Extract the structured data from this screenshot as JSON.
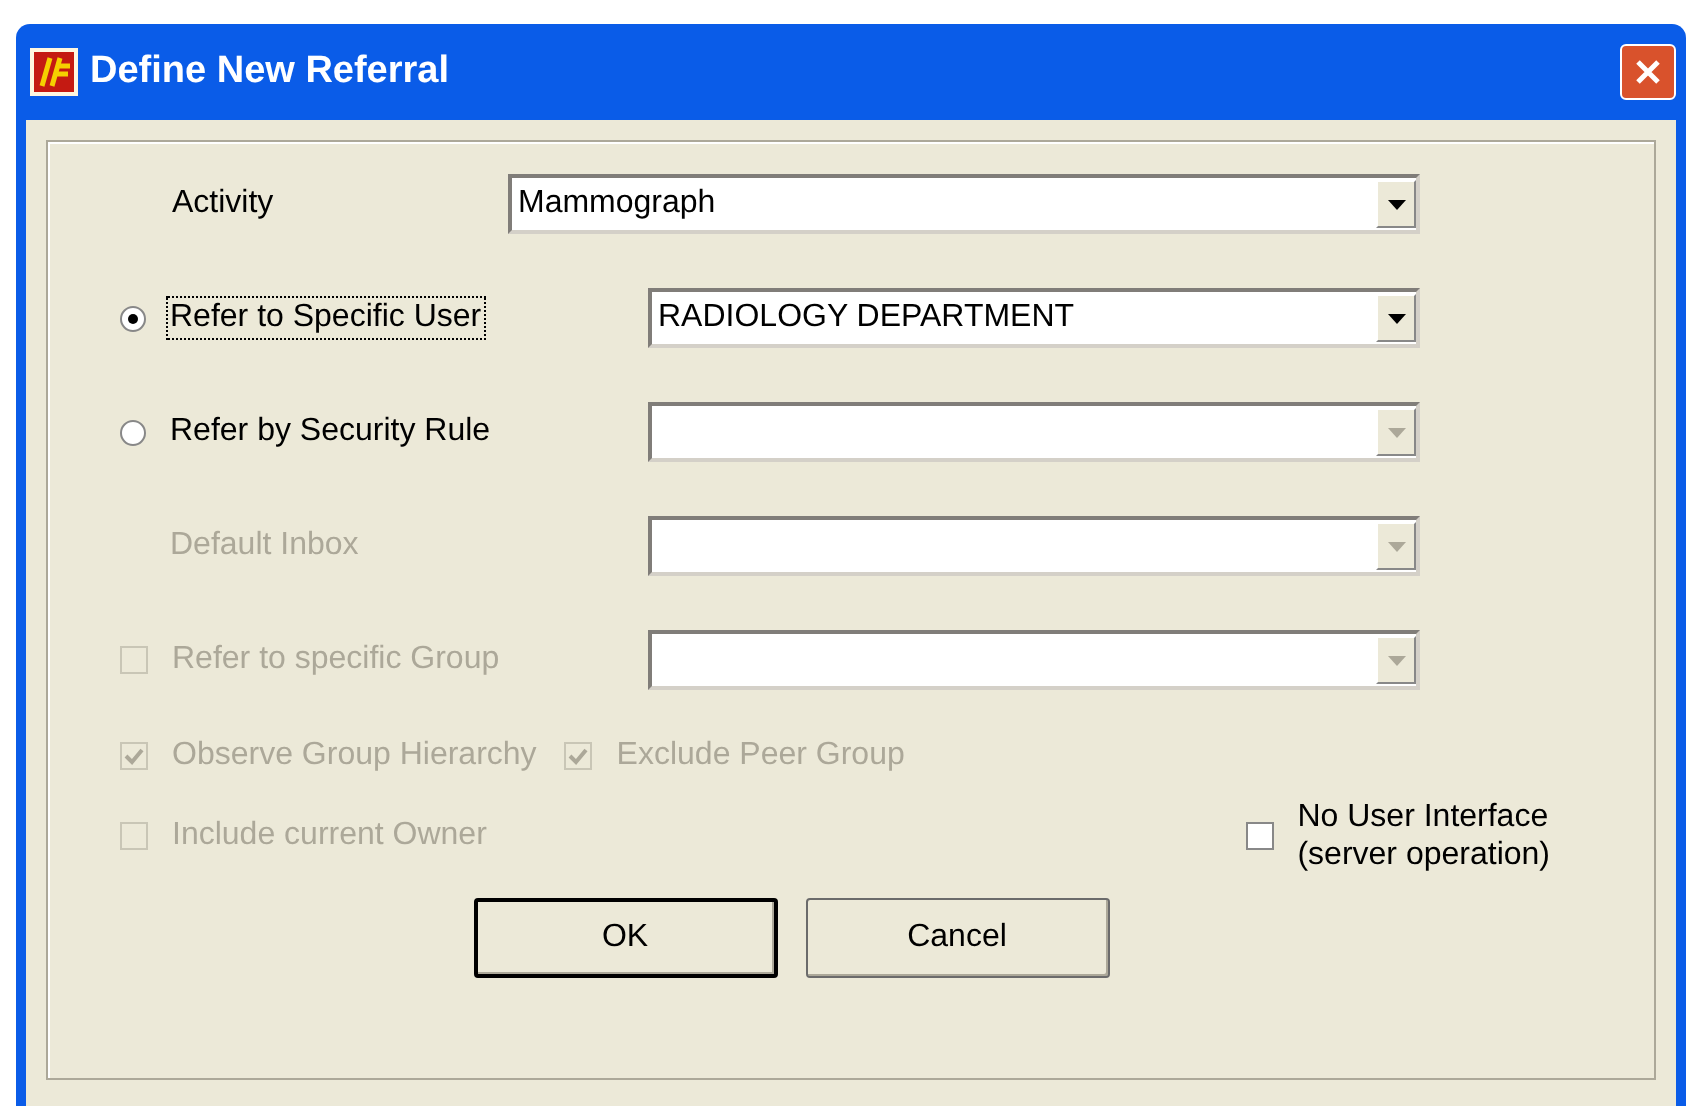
{
  "window": {
    "title": "Define New Referral"
  },
  "activity": {
    "label": "Activity",
    "value": "Mammograph"
  },
  "referral_rows": [
    {
      "kind": "radio",
      "label": "Refer to Specific User",
      "selected": true,
      "focused": true,
      "disabled": false,
      "combo": {
        "value": "RADIOLOGY DEPARTMENT",
        "disabled": false
      }
    },
    {
      "kind": "radio",
      "label": "Refer by Security Rule",
      "selected": false,
      "focused": false,
      "disabled": false,
      "combo": {
        "disabled": true
      }
    },
    {
      "kind": "label",
      "label": "Default Inbox",
      "disabled": true,
      "combo": {
        "disabled": true
      }
    },
    {
      "kind": "checkbox",
      "label": "Refer to specific Group",
      "checked": false,
      "disabled": true,
      "combo": {
        "disabled": true
      }
    }
  ],
  "group_options": [
    {
      "label": "Observe Group Hierarchy",
      "checked": true,
      "disabled": true
    },
    {
      "label": "Exclude Peer Group",
      "checked": true,
      "disabled": true
    }
  ],
  "include_owner": {
    "label": "Include current Owner",
    "checked": false,
    "disabled": true
  },
  "no_user_interface": {
    "label": "No User Interface\n(server operation)",
    "checked": false,
    "disabled": false
  },
  "buttons": [
    {
      "label": "OK",
      "default": true
    },
    {
      "label": "Cancel",
      "default": false
    }
  ]
}
